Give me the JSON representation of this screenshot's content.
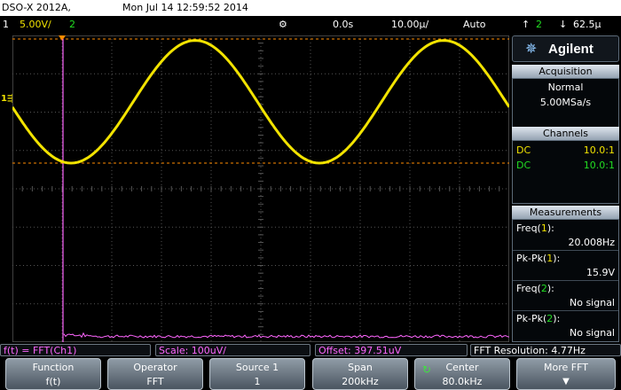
{
  "titlebar": {
    "model": "DSO-X 2012A,",
    "datetime": "Mon Jul 14 12:59:52 2014"
  },
  "statusbar": {
    "ch1_number": "1",
    "ch1_scale": "5.00V/",
    "ch2_number": "2",
    "time_ref": "0.0s",
    "time_scale": "10.00µ/",
    "trigger_mode": "Auto",
    "trigger_source": "2",
    "trigger_level": "62.5µ"
  },
  "panel": {
    "brand": "Agilent",
    "acquisition": {
      "title": "Acquisition",
      "mode": "Normal",
      "rate": "5.00MSa/s"
    },
    "channels": {
      "title": "Channels",
      "rows": [
        {
          "coupling": "DC",
          "probe": "10.0:1"
        },
        {
          "coupling": "DC",
          "probe": "10.0:1"
        }
      ]
    },
    "measurements": {
      "title": "Measurements",
      "items": [
        {
          "name": "Freq(",
          "channel": "1",
          "close": "):",
          "value": "20.008Hz"
        },
        {
          "name": "Pk-Pk(",
          "channel": "1",
          "close": "):",
          "value": "15.9V"
        },
        {
          "name": "Freq(",
          "channel": "2",
          "close": "):",
          "value": "No signal"
        },
        {
          "name": "Pk-Pk(",
          "channel": "2",
          "close": "):",
          "value": "No signal"
        }
      ]
    }
  },
  "infobar": {
    "math": "f(t) = FFT(Ch1)",
    "scale": "Scale: 100uV/",
    "offset": "Offset: 397.51uV",
    "resolution": "FFT Resolution: 4.77Hz"
  },
  "softkeys": [
    {
      "title": "Function",
      "value": "f(t)"
    },
    {
      "title": "Operator",
      "value": "FFT"
    },
    {
      "title": "Source 1",
      "value": "1"
    },
    {
      "title": "Span",
      "value": "200kHz"
    },
    {
      "title": "Center",
      "value": "80.0kHz"
    },
    {
      "title": "More FFT",
      "value": ""
    }
  ],
  "colors": {
    "ch1": "#f2e300",
    "ch2": "#22dd22",
    "math": "#ff66ff",
    "grid": "#555555",
    "trigger": "#ff8c00"
  },
  "waveform": {
    "cycles_visible": 2,
    "phase_at_left_deg": 185,
    "peak_to_peak_divisions": 3.2
  }
}
